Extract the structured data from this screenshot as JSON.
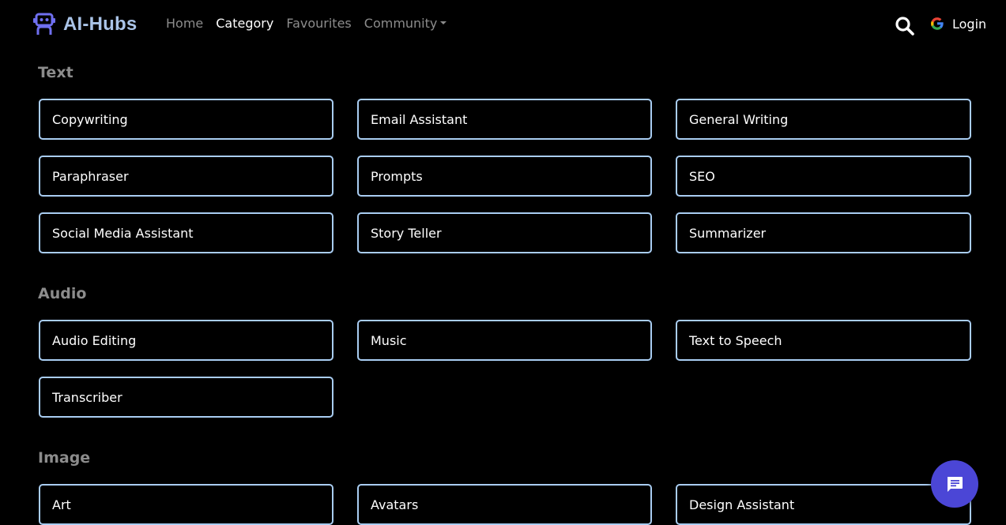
{
  "brand": {
    "name": "AI-Hubs",
    "logo_icon": "robot-icon",
    "color": "#aac4e8"
  },
  "nav": {
    "home": "Home",
    "category": "Category",
    "favourites": "Favourites",
    "community": "Community"
  },
  "header": {
    "search_icon": "search-icon",
    "login_label": "Login",
    "login_icon": "google-icon"
  },
  "sections": {
    "text": {
      "title": "Text",
      "items": [
        "Copywriting",
        "Email Assistant",
        "General Writing",
        "Paraphraser",
        "Prompts",
        "SEO",
        "Social Media Assistant",
        "Story Teller",
        "Summarizer"
      ]
    },
    "audio": {
      "title": "Audio",
      "items": [
        "Audio Editing",
        "Music",
        "Text to Speech",
        "Transcriber"
      ]
    },
    "image": {
      "title": "Image",
      "items": [
        "Art",
        "Avatars",
        "Design Assistant"
      ]
    }
  },
  "chat": {
    "icon": "chat-icon",
    "color": "#4b46d6"
  },
  "colors": {
    "card_border": "#a9cdf2",
    "muted_text": "#8c8c8c",
    "background": "#000000"
  }
}
